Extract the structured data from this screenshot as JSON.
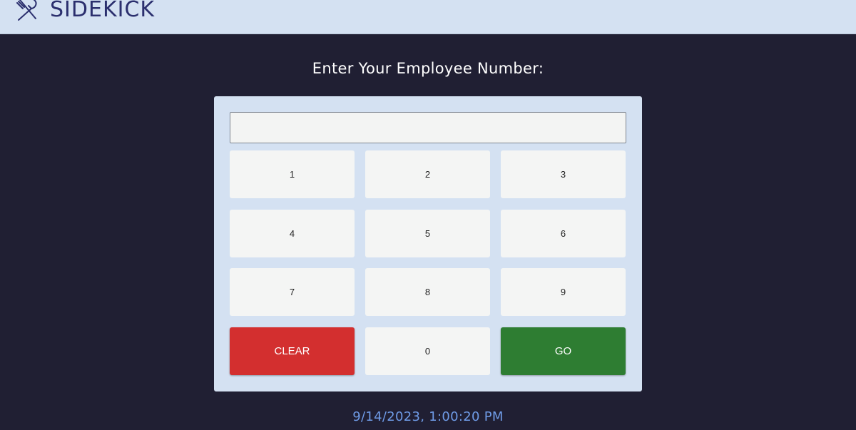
{
  "header": {
    "app_name": "SIDEKICK",
    "logo_icon": "utensils-icon"
  },
  "prompt": {
    "text": "Enter Your Employee Number:"
  },
  "keypad": {
    "input_value": "",
    "keys": {
      "k1": "1",
      "k2": "2",
      "k3": "3",
      "k4": "4",
      "k5": "5",
      "k6": "6",
      "k7": "7",
      "k8": "8",
      "k9": "9",
      "clear": "CLEAR",
      "k0": "0",
      "go": "GO"
    }
  },
  "status": {
    "timestamp": "9/14/2023, 1:00:20 PM"
  },
  "colors": {
    "background": "#201f33",
    "header_background": "#d4e1f2",
    "brand": "#2b2f6e",
    "clear_button": "#d32f2f",
    "go_button": "#2e7d32",
    "timestamp": "#6f9be6"
  }
}
